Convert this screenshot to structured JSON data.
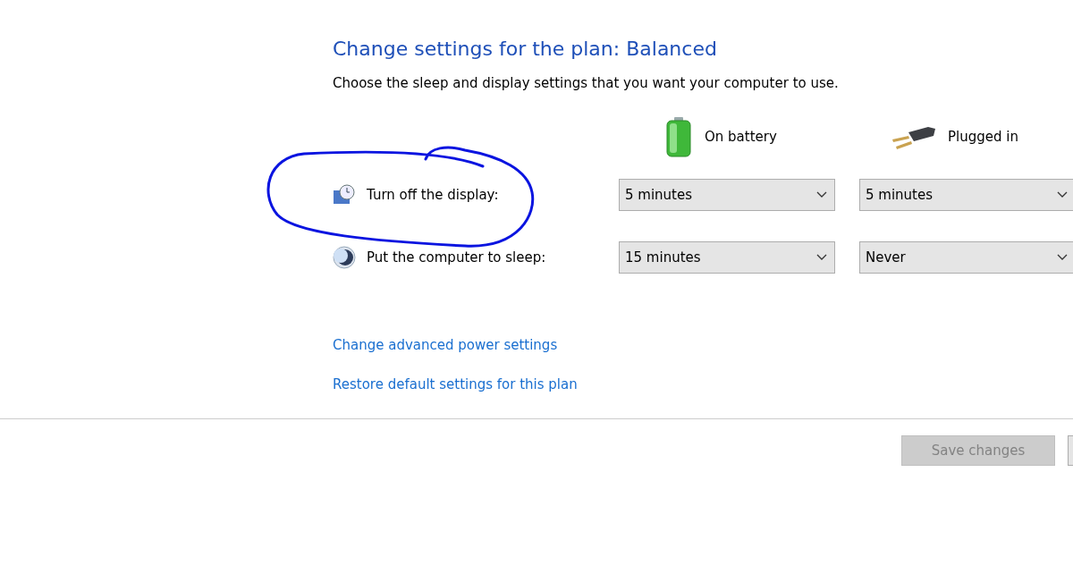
{
  "title": "Change settings for the plan: Balanced",
  "subtitle": "Choose the sleep and display settings that you want your computer to use.",
  "columns": [
    {
      "label": "On battery",
      "kind": "battery"
    },
    {
      "label": "Plugged in",
      "kind": "plug"
    }
  ],
  "settings": [
    {
      "label": "Turn off the display:",
      "kind": "display",
      "values": [
        "5 minutes",
        "5 minutes"
      ]
    },
    {
      "label": "Put the computer to sleep:",
      "kind": "sleep",
      "values": [
        "15 minutes",
        "Never"
      ]
    }
  ],
  "links": [
    "Change advanced power settings",
    "Restore default settings for this plan"
  ],
  "save_button": {
    "label": "Save changes",
    "disabled": true
  }
}
